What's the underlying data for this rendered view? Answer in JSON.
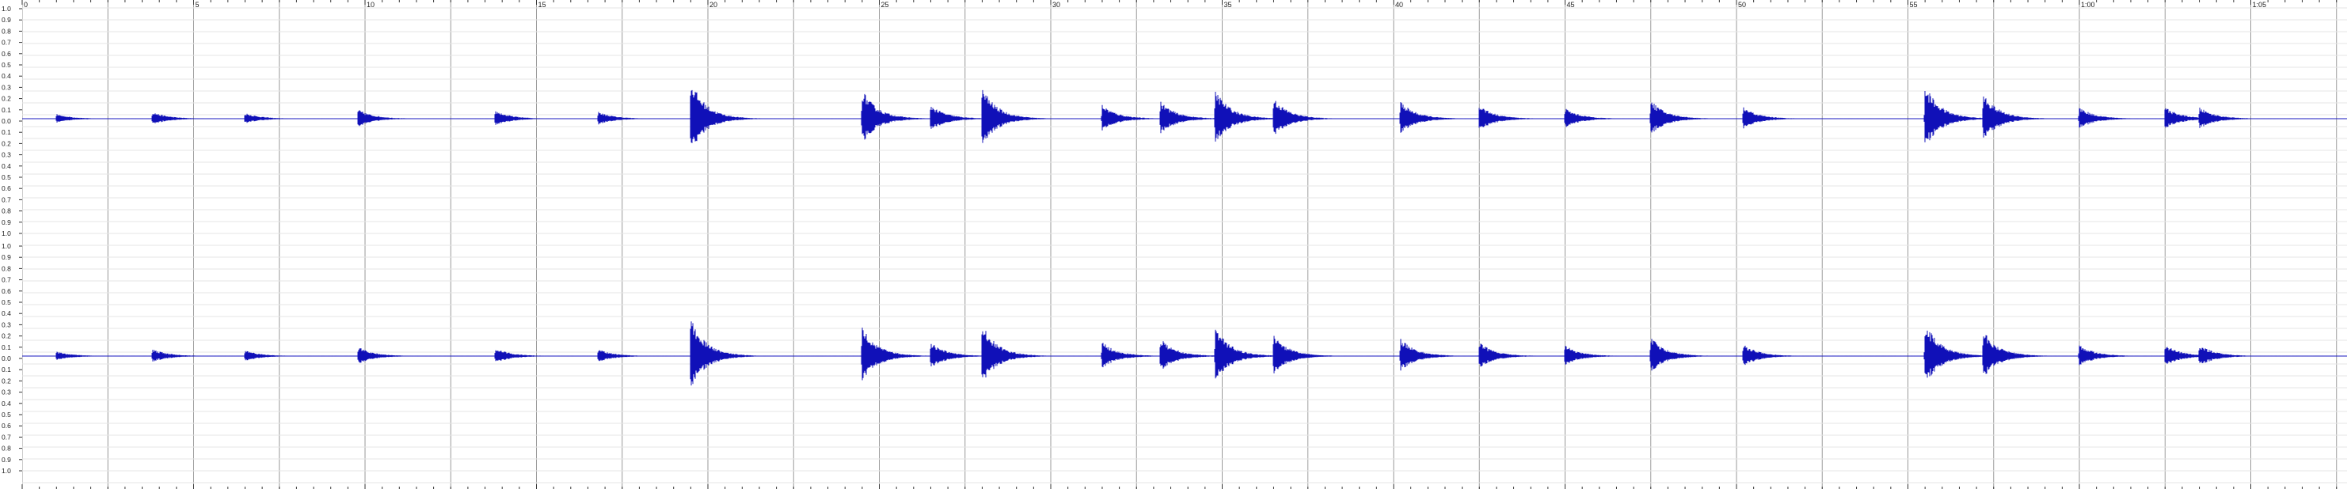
{
  "time_ruler": {
    "tick_labels": [
      "0",
      "5",
      "10",
      "15",
      "20",
      "25",
      "30",
      "35",
      "40",
      "45",
      "50",
      "55",
      "1:00",
      "1:05"
    ],
    "unit_hint": "seconds"
  },
  "amplitude_scale": {
    "channel_1_labels": [
      "1.0",
      "0.9",
      "0.8",
      "0.7",
      "0.6",
      "0.5",
      "0.4",
      "0.3",
      "0.2",
      "0.1",
      "0.0",
      "0.1",
      "0.2",
      "0.3",
      "0.4",
      "0.5",
      "0.6",
      "0.7",
      "0.8",
      "0.9",
      "1.0"
    ],
    "channel_2_labels": [
      "1.0",
      "0.9",
      "0.8",
      "0.7",
      "0.6",
      "0.5",
      "0.4",
      "0.3",
      "0.2",
      "0.1",
      "0.0",
      "0.1",
      "0.2",
      "0.3",
      "0.4",
      "0.5",
      "0.6",
      "0.7",
      "0.8",
      "0.9",
      "1.0"
    ]
  },
  "waveform": {
    "channels": 2,
    "duration_seconds": 68.5,
    "color": "#1010b8",
    "centerline_color": "#2222cc",
    "gridline_color": "#999999",
    "minor_gridline_color": "#e6e6e6"
  },
  "chart_data": {
    "type": "area",
    "x_unit": "seconds",
    "xlim": [
      0,
      68.5
    ],
    "ylim": [
      -1.0,
      1.0
    ],
    "series": [
      {
        "name": "",
        "x": [
          1.0,
          3.8,
          6.5,
          9.8,
          13.8,
          16.8,
          19.5,
          24.5,
          26.5,
          28.0,
          31.5,
          33.2,
          34.8,
          36.5,
          40.2,
          42.5,
          45.0,
          47.5,
          50.2,
          55.5,
          57.2,
          60.0,
          62.5,
          63.5
        ],
        "y": [
          0.04,
          0.06,
          0.05,
          0.08,
          0.07,
          0.06,
          0.33,
          0.25,
          0.12,
          0.27,
          0.12,
          0.15,
          0.25,
          0.18,
          0.15,
          0.12,
          0.09,
          0.16,
          0.1,
          0.29,
          0.22,
          0.1,
          0.1,
          0.1
        ]
      }
    ]
  }
}
